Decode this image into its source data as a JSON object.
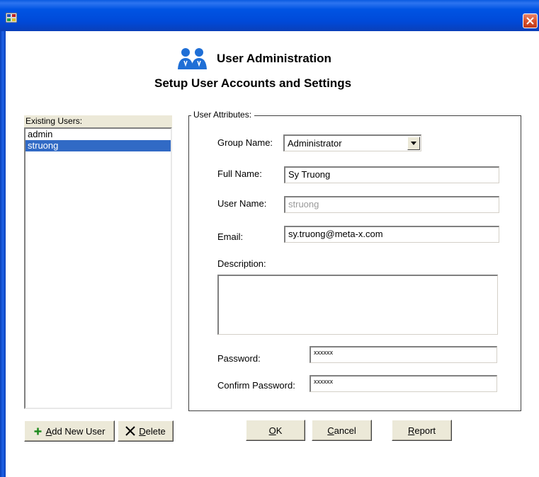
{
  "header": {
    "title": "User Administration",
    "subtitle": "Setup User Accounts and Settings"
  },
  "users": {
    "caption": "Existing Users:",
    "items": [
      {
        "label": "admin",
        "selected": false
      },
      {
        "label": "struong",
        "selected": true
      }
    ],
    "add_key": "A",
    "add_rest": "dd New User",
    "delete_key": "D",
    "delete_rest": "elete"
  },
  "attributes": {
    "legend": "User Attributes:",
    "group_label": "Group Name:",
    "group_value": "Administrator",
    "fullname_label": "Full Name:",
    "fullname_value": "Sy Truong",
    "username_label": "User Name:",
    "username_value": "struong",
    "email_label": "Email:",
    "email_value": "sy.truong@meta-x.com",
    "description_label": "Description:",
    "description_value": "",
    "password_label": "Password:",
    "password_value": "xxxxxx",
    "confirm_label": "Confirm Password:",
    "confirm_value": "xxxxxx"
  },
  "buttons": {
    "ok_key": "O",
    "ok_rest": "K",
    "cancel_key": "C",
    "cancel_rest": "ancel",
    "report_key": "R",
    "report_rest": "eport"
  },
  "colors": {
    "titlebar": "#0054e3",
    "close": "#d9532c",
    "selection": "#316ac5",
    "button_face": "#ece9d8"
  },
  "icons": {
    "app": "app-icon",
    "close": "close-icon",
    "header": "users-icon",
    "add": "plus-icon",
    "delete": "x-icon",
    "dropdown": "chevron-down-icon"
  }
}
